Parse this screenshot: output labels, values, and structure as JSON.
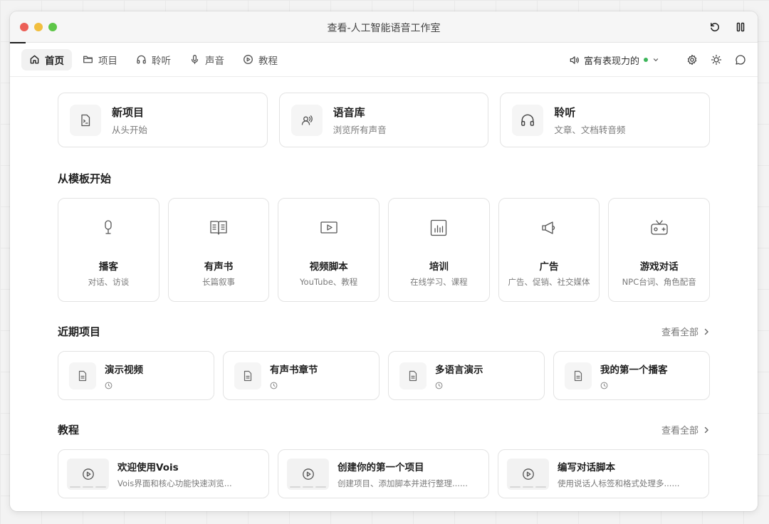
{
  "window": {
    "title": "查看-人工智能语音工作室"
  },
  "nav": {
    "items": [
      {
        "label": "首页",
        "icon": "home-icon",
        "active": true
      },
      {
        "label": "项目",
        "icon": "folder-icon"
      },
      {
        "label": "聆听",
        "icon": "headphones-icon"
      },
      {
        "label": "声音",
        "icon": "microphone-icon"
      },
      {
        "label": "教程",
        "icon": "play-circle-icon"
      }
    ],
    "voice": {
      "label": "富有表现力的",
      "status_color": "#3cb55a"
    }
  },
  "quick": [
    {
      "title": "新项目",
      "subtitle": "从头开始",
      "icon": "new-document-icon"
    },
    {
      "title": "语音库",
      "subtitle": "浏览所有声音",
      "icon": "voice-user-icon"
    },
    {
      "title": "聆听",
      "subtitle": "文章、文档转音频",
      "icon": "headphones-icon"
    }
  ],
  "templates": {
    "title": "从模板开始",
    "items": [
      {
        "title": "播客",
        "subtitle": "对话、访谈",
        "icon": "podcast-mic-icon"
      },
      {
        "title": "有声书",
        "subtitle": "长篇叙事",
        "icon": "open-book-icon"
      },
      {
        "title": "视频脚本",
        "subtitle": "YouTube、教程",
        "icon": "video-play-icon"
      },
      {
        "title": "培训",
        "subtitle": "在线学习、课程",
        "icon": "bar-chart-icon"
      },
      {
        "title": "广告",
        "subtitle": "广告、促销、社交媒体",
        "icon": "megaphone-icon"
      },
      {
        "title": "游戏对话",
        "subtitle": "NPC台词、角色配音",
        "icon": "game-tv-icon"
      }
    ]
  },
  "recent": {
    "title": "近期项目",
    "see_all": "查看全部",
    "items": [
      {
        "title": "演示视频"
      },
      {
        "title": "有声书章节"
      },
      {
        "title": "多语言演示"
      },
      {
        "title": "我的第一个播客"
      }
    ]
  },
  "tutorials": {
    "title": "教程",
    "see_all": "查看全部",
    "items": [
      {
        "title": "欢迎使用Vois",
        "subtitle": "Vois界面和核心功能快速浏览..."
      },
      {
        "title": "创建你的第一个项目",
        "subtitle": "创建项目、添加脚本并进行整理......"
      },
      {
        "title": "编写对话脚本",
        "subtitle": "使用说话人标签和格式处理多......"
      }
    ]
  }
}
